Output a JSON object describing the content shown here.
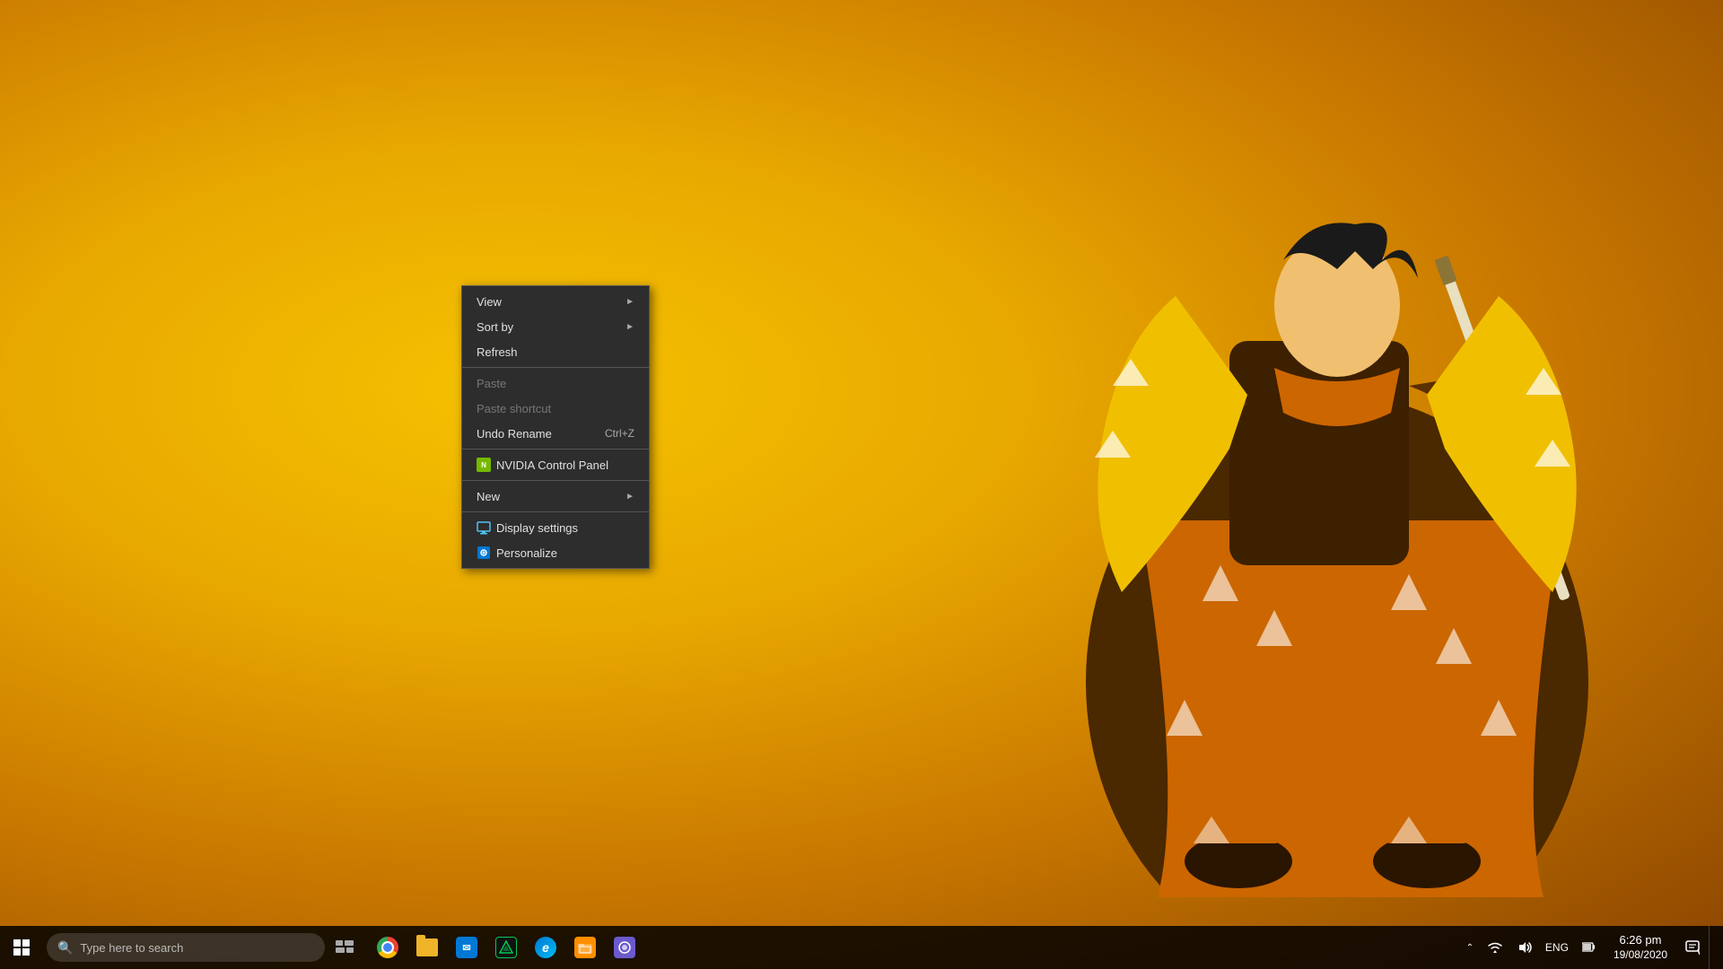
{
  "desktop": {
    "bg_color_center": "#f5c200",
    "bg_color_mid": "#e8a800",
    "bg_color_dark": "#c97800",
    "bg_color_edge": "#8b4500"
  },
  "context_menu": {
    "items": [
      {
        "id": "view",
        "label": "View",
        "has_arrow": true,
        "disabled": false,
        "shortcut": "",
        "has_icon": false
      },
      {
        "id": "sort_by",
        "label": "Sort by",
        "has_arrow": true,
        "disabled": false,
        "shortcut": "",
        "has_icon": false
      },
      {
        "id": "refresh",
        "label": "Refresh",
        "has_arrow": false,
        "disabled": false,
        "shortcut": "",
        "has_icon": false
      },
      {
        "id": "separator1",
        "type": "separator"
      },
      {
        "id": "paste",
        "label": "Paste",
        "has_arrow": false,
        "disabled": true,
        "shortcut": "",
        "has_icon": false
      },
      {
        "id": "paste_shortcut",
        "label": "Paste shortcut",
        "has_arrow": false,
        "disabled": true,
        "shortcut": "",
        "has_icon": false
      },
      {
        "id": "undo_rename",
        "label": "Undo Rename",
        "has_arrow": false,
        "disabled": false,
        "shortcut": "Ctrl+Z",
        "has_icon": false
      },
      {
        "id": "separator2",
        "type": "separator"
      },
      {
        "id": "nvidia",
        "label": "NVIDIA Control Panel",
        "has_arrow": false,
        "disabled": false,
        "shortcut": "",
        "has_icon": true,
        "icon_type": "nvidia"
      },
      {
        "id": "separator3",
        "type": "separator"
      },
      {
        "id": "new",
        "label": "New",
        "has_arrow": true,
        "disabled": false,
        "shortcut": "",
        "has_icon": false
      },
      {
        "id": "separator4",
        "type": "separator"
      },
      {
        "id": "display_settings",
        "label": "Display settings",
        "has_arrow": false,
        "disabled": false,
        "shortcut": "",
        "has_icon": true,
        "icon_type": "display"
      },
      {
        "id": "personalize",
        "label": "Personalize",
        "has_arrow": false,
        "disabled": false,
        "shortcut": "",
        "has_icon": true,
        "icon_type": "personalize"
      }
    ]
  },
  "taskbar": {
    "search_placeholder": "Type here to search",
    "pinned_apps": [
      {
        "id": "chrome",
        "label": "Google Chrome",
        "icon_type": "chrome"
      },
      {
        "id": "file_explorer",
        "label": "File Explorer",
        "icon_type": "folder"
      },
      {
        "id": "outlook",
        "label": "Microsoft Outlook",
        "icon_type": "mail",
        "color": "#0078d4"
      },
      {
        "id": "predator",
        "label": "Predator Sense",
        "icon_type": "predator",
        "color": "#00c853"
      },
      {
        "id": "edge",
        "label": "Microsoft Edge",
        "icon_type": "edge"
      },
      {
        "id": "filemanager",
        "label": "File Manager",
        "icon_type": "filemanager",
        "color": "#ff8f00"
      },
      {
        "id": "unknown",
        "label": "App",
        "icon_type": "unknown",
        "color": "#7b68ee"
      }
    ],
    "tray": {
      "hidden_icons_label": "Show hidden icons",
      "time": "6:26 pm",
      "date": "19/08/2020",
      "language": "ENG",
      "notification_label": "Action Center"
    }
  }
}
